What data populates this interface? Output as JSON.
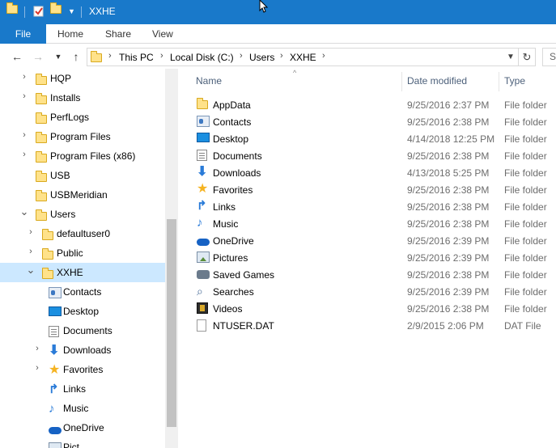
{
  "window": {
    "title": "XXHE"
  },
  "ribbon": {
    "tabs": [
      "File",
      "Home",
      "Share",
      "View"
    ]
  },
  "address": {
    "crumbs": [
      "This PC",
      "Local Disk (C:)",
      "Users",
      "XXHE"
    ],
    "search_placeholder": "S"
  },
  "nav_tree": [
    {
      "label": "HQP",
      "expandable": true
    },
    {
      "label": "Installs",
      "expandable": true
    },
    {
      "label": "PerfLogs",
      "expandable": false
    },
    {
      "label": "Program Files",
      "expandable": true
    },
    {
      "label": "Program Files (x86)",
      "expandable": true
    },
    {
      "label": "USB",
      "expandable": false
    },
    {
      "label": "USBMeridian",
      "expandable": false
    },
    {
      "label": "Users",
      "expanded": true
    },
    {
      "label": "defaultuser0",
      "expandable": true
    },
    {
      "label": "Public",
      "expandable": true
    },
    {
      "label": "XXHE",
      "expanded": true,
      "selected": true
    },
    {
      "label": "Contacts",
      "icon": "contacts-icon"
    },
    {
      "label": "Desktop",
      "icon": "desktop-icon"
    },
    {
      "label": "Documents",
      "icon": "documents-icon"
    },
    {
      "label": "Downloads",
      "icon": "downloads-icon",
      "expandable": true
    },
    {
      "label": "Favorites",
      "icon": "favorites-icon",
      "expandable": true
    },
    {
      "label": "Links",
      "icon": "links-icon"
    },
    {
      "label": "Music",
      "icon": "music-icon"
    },
    {
      "label": "OneDrive",
      "icon": "onedrive-icon"
    },
    {
      "label": "Pict",
      "icon": "pictures-icon"
    }
  ],
  "columns": {
    "name": "Name",
    "date": "Date modified",
    "type": "Type"
  },
  "files": [
    {
      "name": "AppData",
      "date": "9/25/2016 2:37 PM",
      "type": "File folder",
      "icon": "folder-icon"
    },
    {
      "name": "Contacts",
      "date": "9/25/2016 2:38 PM",
      "type": "File folder",
      "icon": "contacts-icon"
    },
    {
      "name": "Desktop",
      "date": "4/14/2018 12:25 PM",
      "type": "File folder",
      "icon": "desktop-icon"
    },
    {
      "name": "Documents",
      "date": "9/25/2016 2:38 PM",
      "type": "File folder",
      "icon": "documents-icon"
    },
    {
      "name": "Downloads",
      "date": "4/13/2018 5:25 PM",
      "type": "File folder",
      "icon": "downloads-icon"
    },
    {
      "name": "Favorites",
      "date": "9/25/2016 2:38 PM",
      "type": "File folder",
      "icon": "favorites-icon"
    },
    {
      "name": "Links",
      "date": "9/25/2016 2:38 PM",
      "type": "File folder",
      "icon": "links-icon"
    },
    {
      "name": "Music",
      "date": "9/25/2016 2:38 PM",
      "type": "File folder",
      "icon": "music-icon"
    },
    {
      "name": "OneDrive",
      "date": "9/25/2016 2:39 PM",
      "type": "File folder",
      "icon": "onedrive-icon"
    },
    {
      "name": "Pictures",
      "date": "9/25/2016 2:39 PM",
      "type": "File folder",
      "icon": "pictures-icon"
    },
    {
      "name": "Saved Games",
      "date": "9/25/2016 2:38 PM",
      "type": "File folder",
      "icon": "saved-games-icon"
    },
    {
      "name": "Searches",
      "date": "9/25/2016 2:39 PM",
      "type": "File folder",
      "icon": "searches-icon"
    },
    {
      "name": "Videos",
      "date": "9/25/2016 2:38 PM",
      "type": "File folder",
      "icon": "videos-icon"
    },
    {
      "name": "NTUSER.DAT",
      "date": "2/9/2015 2:06 PM",
      "type": "DAT File",
      "icon": "file-icon"
    }
  ],
  "colors": {
    "accent": "#1979ca",
    "selection": "#cce8ff",
    "header_text": "#4c607a"
  }
}
